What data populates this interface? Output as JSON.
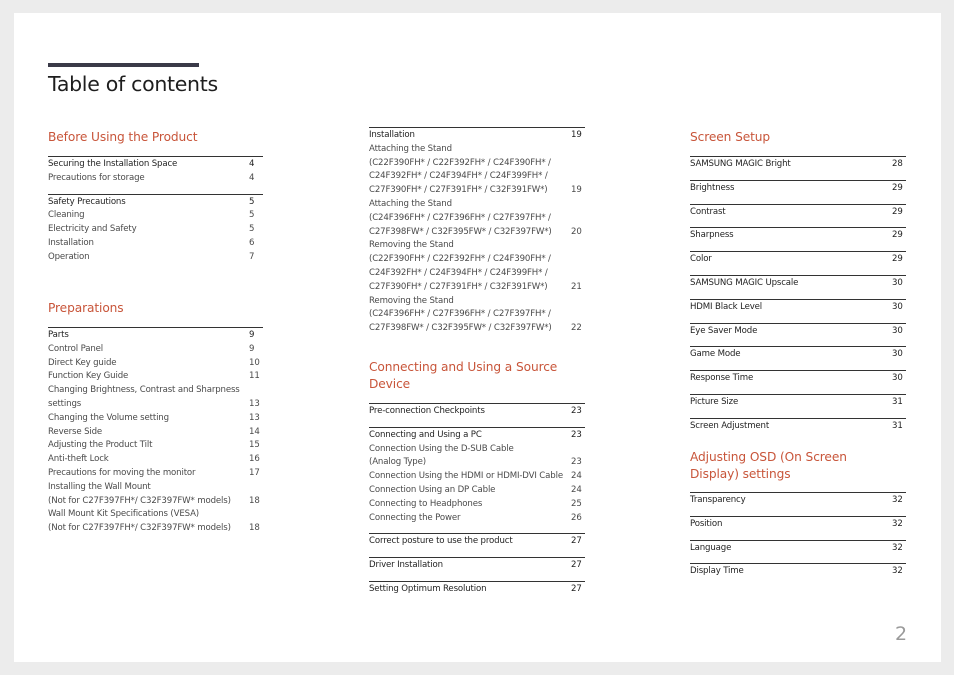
{
  "header": {
    "title": "Table of contents"
  },
  "page_number": "2",
  "accent_color": "#c8553a",
  "sections": {
    "before": {
      "title": "Before Using the Product",
      "groups": [
        [
          {
            "label": "Securing the Installation Space",
            "page": "4",
            "head": true
          },
          {
            "label": "Precautions for storage",
            "page": "4"
          }
        ],
        [
          {
            "label": "Safety Precautions",
            "page": "5",
            "head": true
          },
          {
            "label": "Cleaning",
            "page": "5"
          },
          {
            "label": "Electricity and Safety",
            "page": "5"
          },
          {
            "label": "Installation",
            "page": "6"
          },
          {
            "label": "Operation",
            "page": "7"
          }
        ]
      ]
    },
    "preparations": {
      "title": "Preparations",
      "groups": [
        [
          {
            "label": "Parts",
            "page": "9",
            "head": true
          },
          {
            "label": "Control Panel",
            "page": "9"
          },
          {
            "label": "Direct Key guide",
            "page": "10"
          },
          {
            "label": "Function Key Guide",
            "page": "11"
          },
          {
            "label": "Changing Brightness, Contrast and Sharpness\nsettings",
            "page": "13"
          },
          {
            "label": "Changing the Volume setting",
            "page": "13"
          },
          {
            "label": "Reverse Side",
            "page": "14"
          },
          {
            "label": "Adjusting the Product Tilt",
            "page": "15"
          },
          {
            "label": "Anti-theft Lock",
            "page": "16"
          },
          {
            "label": "Precautions for moving the monitor",
            "page": "17"
          },
          {
            "label": "Installing the Wall Mount\n(Not for C27F397FH*/ C32F397FW* models)",
            "page": "18"
          },
          {
            "label": "Wall Mount Kit Specifications (VESA)\n(Not for C27F397FH*/ C32F397FW* models)",
            "page": "18"
          }
        ]
      ]
    },
    "installation": {
      "title": "",
      "groups": [
        [
          {
            "label": "Installation",
            "page": "19",
            "head": true
          },
          {
            "label": "Attaching the Stand\n(C22F390FH* / C22F392FH* / C24F390FH* /\nC24F392FH* / C24F394FH* / C24F399FH* /\nC27F390FH* / C27F391FH* / C32F391FW*)",
            "page": "19"
          },
          {
            "label": "Attaching the Stand\n(C24F396FH* / C27F396FH* / C27F397FH* /\nC27F398FW* / C32F395FW* / C32F397FW*)",
            "page": "20"
          },
          {
            "label": "Removing the Stand\n(C22F390FH* / C22F392FH* / C24F390FH* /\nC24F392FH* / C24F394FH* / C24F399FH* /\nC27F390FH* / C27F391FH* / C32F391FW*)",
            "page": "21"
          },
          {
            "label": "Removing the Stand\n(C24F396FH* / C27F396FH* / C27F397FH* /\nC27F398FW* / C32F395FW* / C32F397FW*)",
            "page": "22"
          }
        ]
      ]
    },
    "connecting": {
      "title": "Connecting and Using a Source Device",
      "groups": [
        [
          {
            "label": "Pre-connection Checkpoints",
            "page": "23",
            "head": true
          }
        ],
        [
          {
            "label": "Connecting and Using a PC",
            "page": "23",
            "head": true
          },
          {
            "label": "Connection Using the D-SUB Cable\n(Analog Type)",
            "page": "23"
          },
          {
            "label": "Connection Using the HDMI or HDMI-DVI Cable",
            "page": "24"
          },
          {
            "label": "Connection Using an DP Cable",
            "page": "24"
          },
          {
            "label": "Connecting to Headphones",
            "page": "25"
          },
          {
            "label": "Connecting the Power",
            "page": "26"
          }
        ],
        [
          {
            "label": "Correct posture to use the product",
            "page": "27",
            "head": true
          }
        ],
        [
          {
            "label": "Driver Installation",
            "page": "27",
            "head": true
          }
        ],
        [
          {
            "label": "Setting Optimum Resolution",
            "page": "27",
            "head": true
          }
        ]
      ]
    },
    "screen": {
      "title": "Screen Setup",
      "groups": [
        [
          {
            "label": "SAMSUNG MAGIC Bright",
            "page": "28",
            "head": true
          }
        ],
        [
          {
            "label": "Brightness",
            "page": "29",
            "head": true
          }
        ],
        [
          {
            "label": "Contrast",
            "page": "29",
            "head": true
          }
        ],
        [
          {
            "label": "Sharpness",
            "page": "29",
            "head": true
          }
        ],
        [
          {
            "label": "Color",
            "page": "29",
            "head": true
          }
        ],
        [
          {
            "label": "SAMSUNG MAGIC Upscale",
            "page": "30",
            "head": true
          }
        ],
        [
          {
            "label": "HDMI Black Level",
            "page": "30",
            "head": true
          }
        ],
        [
          {
            "label": "Eye Saver Mode",
            "page": "30",
            "head": true
          }
        ],
        [
          {
            "label": "Game Mode",
            "page": "30",
            "head": true
          }
        ],
        [
          {
            "label": "Response Time",
            "page": "30",
            "head": true
          }
        ],
        [
          {
            "label": "Picture Size",
            "page": "31",
            "head": true
          }
        ],
        [
          {
            "label": "Screen Adjustment",
            "page": "31",
            "head": true
          }
        ]
      ]
    },
    "osd": {
      "title": "Adjusting OSD (On Screen\nDisplay) settings",
      "groups": [
        [
          {
            "label": "Transparency",
            "page": "32",
            "head": true
          }
        ],
        [
          {
            "label": "Position",
            "page": "32",
            "head": true
          }
        ],
        [
          {
            "label": "Language",
            "page": "32",
            "head": true
          }
        ],
        [
          {
            "label": "Display Time",
            "page": "32",
            "head": true
          }
        ]
      ]
    }
  }
}
